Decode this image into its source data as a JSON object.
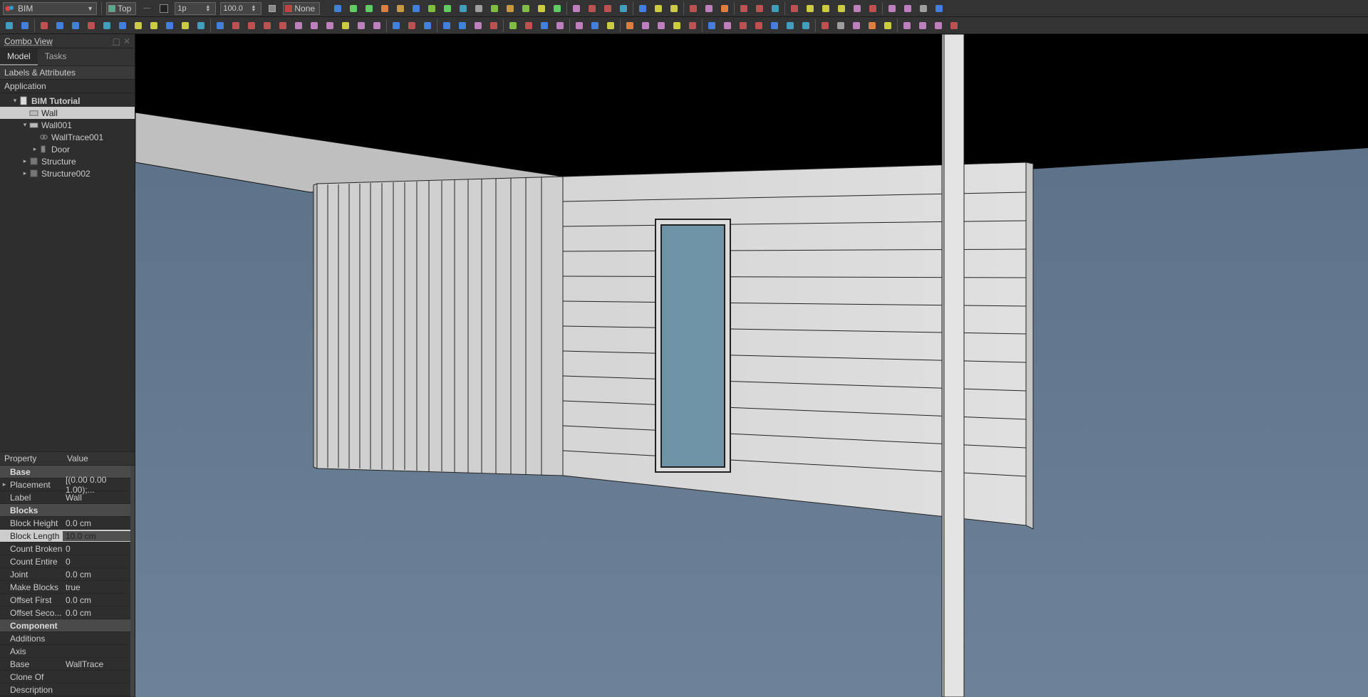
{
  "workbench": {
    "name": "BIM"
  },
  "workingPlane": {
    "label": "Top"
  },
  "lineWidth": {
    "label": "1p",
    "value": "1"
  },
  "scale": {
    "value": "100.0"
  },
  "styleGroup": {
    "label": "None"
  },
  "panel": {
    "title": "Combo View",
    "tabs": {
      "model": "Model",
      "tasks": "Tasks"
    },
    "labelsHeader": "Labels & Attributes",
    "applicationLabel": "Application"
  },
  "tree": {
    "doc": "BIM Tutorial",
    "items": [
      {
        "id": "wall",
        "label": "Wall",
        "indent": 2,
        "icon": "wall",
        "selected": true
      },
      {
        "id": "wall001",
        "label": "Wall001",
        "indent": 2,
        "icon": "wall",
        "caret": "▾"
      },
      {
        "id": "walltrace001",
        "label": "WallTrace001",
        "indent": 3,
        "icon": "link"
      },
      {
        "id": "door",
        "label": "Door",
        "indent": 3,
        "icon": "door",
        "caret": "▸"
      },
      {
        "id": "structure",
        "label": "Structure",
        "indent": 2,
        "icon": "struct",
        "caret": "▸"
      },
      {
        "id": "structure002",
        "label": "Structure002",
        "indent": 2,
        "icon": "struct",
        "caret": "▸"
      }
    ]
  },
  "propsHeader": {
    "property": "Property",
    "value": "Value"
  },
  "propGroups": {
    "base": {
      "title": "Base"
    },
    "blocks": {
      "title": "Blocks"
    },
    "component": {
      "title": "Component"
    }
  },
  "props": {
    "placement": {
      "n": "Placement",
      "v": "[(0.00 0.00 1.00);..."
    },
    "label": {
      "n": "Label",
      "v": "Wall"
    },
    "blockHeight": {
      "n": "Block Height",
      "v": "0.0 cm"
    },
    "blockLength": {
      "n": "Block Length",
      "v": "10.0 cm"
    },
    "countBroken": {
      "n": "Count Broken",
      "v": "0"
    },
    "countEntire": {
      "n": "Count Entire",
      "v": "0"
    },
    "joint": {
      "n": "Joint",
      "v": "0.0 cm"
    },
    "makeBlocks": {
      "n": "Make Blocks",
      "v": "true"
    },
    "offsetFirst": {
      "n": "Offset First",
      "v": "0.0 cm"
    },
    "offsetSecond": {
      "n": "Offset Seco...",
      "v": "0.0 cm"
    },
    "additions": {
      "n": "Additions",
      "v": ""
    },
    "axis": {
      "n": "Axis",
      "v": ""
    },
    "base": {
      "n": "Base",
      "v": "WallTrace"
    },
    "cloneOf": {
      "n": "Clone Of",
      "v": ""
    },
    "description": {
      "n": "Description",
      "v": ""
    }
  },
  "toolbarIcons": {
    "row1": [
      "grid",
      "snap-end",
      "snap-mid",
      "snap-center",
      "snap-angle",
      "snap-intersect",
      "snap-perp",
      "snap-ext",
      "snap-parallel",
      "snap-special",
      "snap-near",
      "snap-ortho",
      "snap-grid",
      "snap-wp",
      "snap-dim",
      "",
      "tools",
      "wrench",
      "layers",
      "box",
      "",
      "clip",
      "hatch-r",
      "hatch-o",
      "",
      "manage",
      "check",
      "spreadsheet",
      "",
      "text-a",
      "text-s",
      "dim",
      "",
      "revert",
      "up-down",
      "grid-sm",
      "grid-lg",
      "globe",
      "sphere",
      "",
      "scale",
      "paint",
      "db",
      "star"
    ],
    "row2": [
      "new",
      "open",
      "",
      "sketch",
      "line",
      "wire",
      "circle",
      "arc",
      "arc3",
      "ellipse",
      "polygon",
      "rect",
      "bspline",
      "bez",
      "",
      "move",
      "rotate",
      "mirror",
      "offset",
      "trimex",
      "array",
      "align",
      "point",
      "shape2d",
      "link2",
      "clone",
      "",
      "wall",
      "window",
      "door",
      "",
      "slab",
      "beam",
      "beam2",
      "column",
      "",
      "cut-plane",
      "stairs",
      "pipe",
      "rebar",
      "",
      "level",
      "axis",
      "section",
      "",
      "dim-builder",
      "dim-h",
      "dim-v",
      "dim-ang",
      "leader",
      "",
      "plus",
      "right",
      "reload",
      "record",
      "back",
      "fwd",
      "ext",
      "",
      "remove",
      "up",
      "move2",
      "w",
      "reload2",
      "",
      "plus2",
      "minus",
      "panel",
      "check2"
    ]
  }
}
